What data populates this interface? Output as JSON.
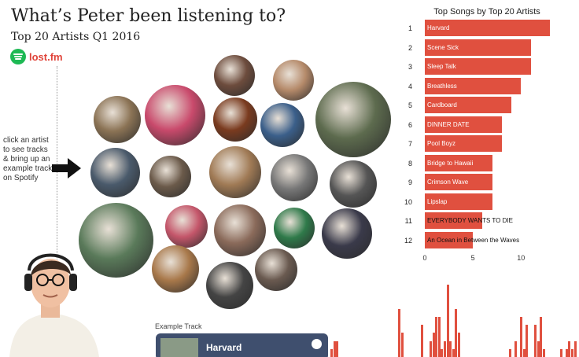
{
  "header": {
    "title": "What’s Peter been listening to?",
    "subtitle": "Top 20 Artists Q1 2016"
  },
  "logo": {
    "text": "lost.fm",
    "icon": "spotify-icon",
    "icon_color": "#1DB954",
    "text_color": "#e0443a"
  },
  "instructions": "click an artist to see tracks & bring up an example track on Spotify",
  "arrow_icon": "arrow-right-icon",
  "artist_bubbles": [
    {
      "name": "artist-1",
      "color": "#8b7355"
    },
    {
      "name": "artist-2",
      "color": "#c94a6c"
    },
    {
      "name": "artist-3",
      "color": "#6d4c3d"
    },
    {
      "name": "artist-4",
      "color": "#b58a6a"
    },
    {
      "name": "artist-5",
      "color": "#7a3b1f"
    },
    {
      "name": "artist-6",
      "color": "#3b5f8a"
    },
    {
      "name": "artist-7",
      "color": "#5d6b4e"
    },
    {
      "name": "artist-8",
      "color": "#4a5a6b"
    },
    {
      "name": "artist-9",
      "color": "#6b5a4a"
    },
    {
      "name": "artist-10",
      "color": "#a07a55"
    },
    {
      "name": "artist-11",
      "color": "#777777"
    },
    {
      "name": "artist-12",
      "color": "#555555"
    },
    {
      "name": "artist-13",
      "color": "#5a7a5a"
    },
    {
      "name": "artist-14",
      "color": "#c4566a"
    },
    {
      "name": "artist-15",
      "color": "#8a6a5a"
    },
    {
      "name": "artist-16",
      "color": "#2f7a4a"
    },
    {
      "name": "artist-17",
      "color": "#3a3a4a"
    },
    {
      "name": "artist-18",
      "color": "#a8784a"
    },
    {
      "name": "artist-19",
      "color": "#6a5a50"
    },
    {
      "name": "artist-20",
      "color": "#444444"
    }
  ],
  "chart_data": {
    "type": "bar",
    "orientation": "horizontal",
    "title": "Top Songs by Top 20 Artists",
    "ranks": [
      "1",
      "2",
      "3",
      "4",
      "5",
      "6",
      "7",
      "8",
      "9",
      "10",
      "11",
      "12"
    ],
    "categories": [
      "Harvard",
      "Scene Sick",
      "Sleep Talk",
      "Breathless",
      "Cardboard",
      "DINNER DATE",
      "Pool Boyz",
      "Bridge to Hawaii",
      "Crimson Wave",
      "Lipslap",
      "EVERYBODY WANTS TO DIE",
      "An Ocean in Between the Waves"
    ],
    "values": [
      13,
      11,
      11,
      10,
      9,
      8,
      8,
      7,
      7,
      7,
      6,
      5
    ],
    "xlim": [
      0,
      13
    ],
    "xticks": [
      "0",
      "5",
      "10"
    ],
    "bar_color": "#e0503f",
    "grid": false
  },
  "example_track": {
    "label": "Example Track",
    "title": "Harvard",
    "icon": "spotify-icon"
  },
  "history_chart": {
    "type": "bar",
    "values": [
      1,
      2,
      2,
      0,
      0,
      0,
      0,
      0,
      0,
      0,
      0,
      0,
      0,
      0,
      0,
      0,
      0,
      0,
      0,
      0,
      0,
      0,
      0,
      0,
      6,
      3,
      0,
      0,
      0,
      0,
      0,
      0,
      4,
      0,
      0,
      2,
      3,
      5,
      5,
      1,
      2,
      9,
      2,
      1,
      6,
      3,
      0,
      0,
      0,
      0,
      0,
      0,
      0,
      0,
      0,
      0,
      0,
      0,
      0,
      0,
      0,
      0,
      0,
      1,
      0,
      2,
      0,
      5,
      1,
      4,
      0,
      0,
      4,
      2,
      5,
      1,
      0,
      0,
      0,
      0,
      0,
      1,
      0,
      1,
      2,
      1,
      2
    ],
    "color": "#e0503f"
  }
}
